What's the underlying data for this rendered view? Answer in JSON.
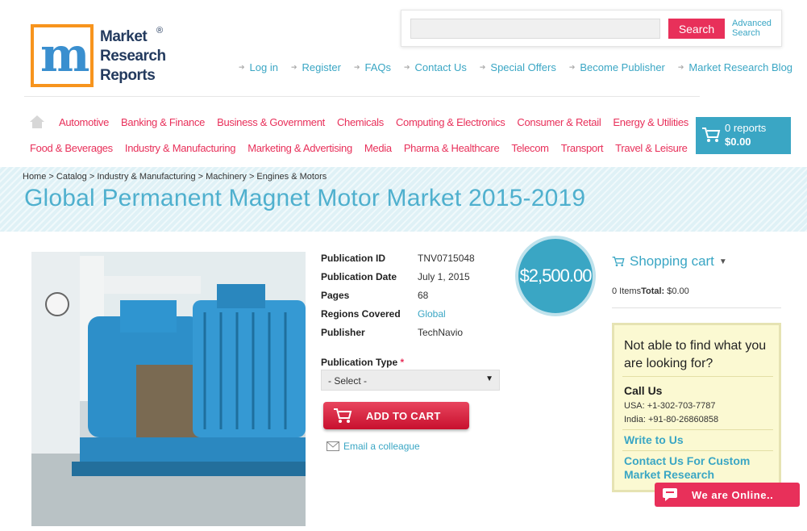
{
  "logo": {
    "lines": [
      "Market",
      "Research",
      "Reports"
    ],
    "reg": "®"
  },
  "search": {
    "placeholder": "",
    "button": "Search",
    "advanced": "Advanced Search"
  },
  "top_links": [
    "Log in",
    "Register",
    "FAQs",
    "Contact Us",
    "Special Offers",
    "Become Publisher",
    "Market Research Blog"
  ],
  "categories_row1": [
    "Automotive",
    "Banking & Finance",
    "Business & Government",
    "Chemicals",
    "Computing & Electronics",
    "Consumer & Retail",
    "Energy & Utilities"
  ],
  "categories_row2": [
    "Food & Beverages",
    "Industry & Manufacturing",
    "Marketing & Advertising",
    "Media",
    "Pharma & Healthcare",
    "Telecom",
    "Transport",
    "Travel & Leisure"
  ],
  "cart_box": {
    "reports": "0 reports",
    "total": "$0.00"
  },
  "breadcrumb": "Home > Catalog > Industry & Manufacturing > Machinery > Engines & Motors",
  "title": "Global Permanent Magnet Motor Market 2015-2019",
  "details": {
    "pub_id_label": "Publication ID",
    "pub_id": "TNV0715048",
    "pub_date_label": "Publication Date",
    "pub_date": "July 1, 2015",
    "pages_label": "Pages",
    "pages": "68",
    "regions_label": "Regions Covered",
    "regions": "Global",
    "publisher_label": "Publisher",
    "publisher": "TechNavio"
  },
  "price": "$2,500.00",
  "pub_type": {
    "label": "Publication Type",
    "required": "*",
    "selected": "- Select -"
  },
  "add_to_cart": "ADD TO CART",
  "email_colleague": "Email a colleague",
  "shopping_cart": {
    "title": "Shopping cart",
    "items": "0 Items",
    "total_label": "Total:",
    "total": "$0.00"
  },
  "help": {
    "title": "Not able to find what you are looking for?",
    "call_us": "Call Us",
    "usa": "USA: +1-302-703-7787",
    "india": "India: +91-80-26860858",
    "write_to_us": "Write to Us",
    "custom": "Contact Us For Custom Market Research"
  },
  "online": "We are Online..",
  "colors": {
    "accent_pink": "#e8305a",
    "accent_blue": "#3aa6c4",
    "logo_orange": "#f7941d"
  },
  "icons": [
    "home-icon",
    "cart-icon",
    "arrow-icon",
    "chevron-down-icon",
    "mail-icon",
    "chat-icon"
  ]
}
